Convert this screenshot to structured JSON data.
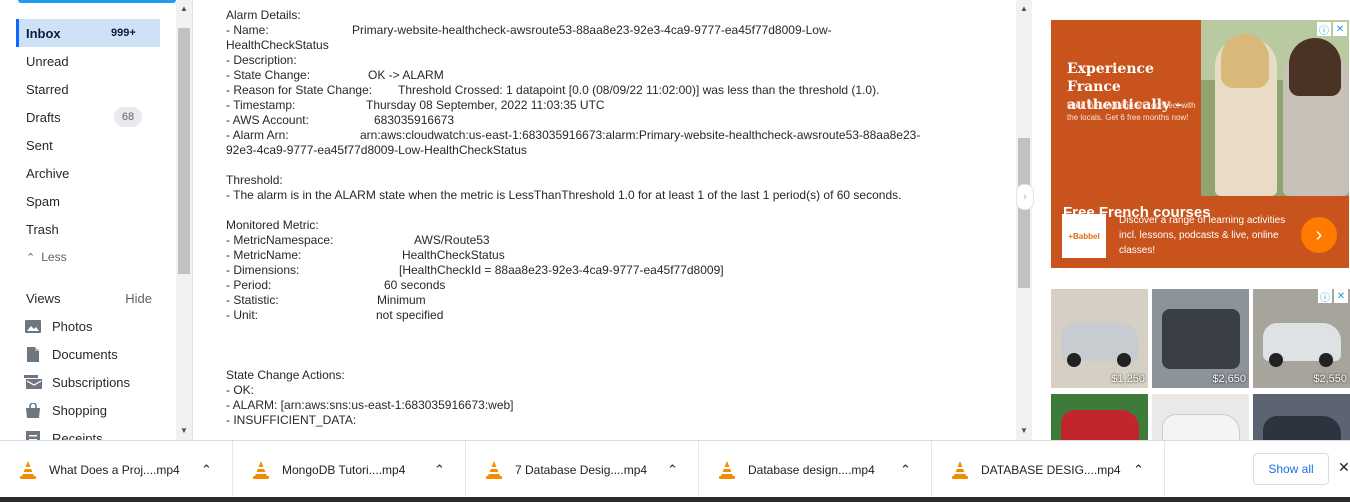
{
  "sidebar": {
    "folders": [
      {
        "label": "Inbox",
        "count": "999+"
      },
      {
        "label": "Unread"
      },
      {
        "label": "Starred"
      },
      {
        "label": "Drafts",
        "badge": "68"
      },
      {
        "label": "Sent"
      },
      {
        "label": "Archive"
      },
      {
        "label": "Spam"
      },
      {
        "label": "Trash"
      }
    ],
    "less_label": "Less",
    "views_label": "Views",
    "hide_label": "Hide",
    "views": [
      {
        "label": "Photos",
        "icon": "photos-icon"
      },
      {
        "label": "Documents",
        "icon": "document-icon"
      },
      {
        "label": "Subscriptions",
        "icon": "subscriptions-icon"
      },
      {
        "label": "Shopping",
        "icon": "shopping-bag-icon"
      },
      {
        "label": "Receipts",
        "icon": "receipt-icon"
      }
    ]
  },
  "message": {
    "alarm_header": "Alarm Details:",
    "name_key": "- Name:",
    "name_val_1": "Primary-website-healthcheck-awsroute53-88aa8e23-92e3-4ca9-9777-ea45f77d8009-Low-",
    "name_val_2": "HealthCheckStatus",
    "description_key": "- Description:",
    "state_change_key": "- State Change:",
    "state_change_val": "OK -> ALARM",
    "reason_key": "- Reason for State Change:",
    "reason_val": "Threshold Crossed: 1 datapoint [0.0 (08/09/22 11:02:00)] was less than the threshold (1.0).",
    "timestamp_key": "- Timestamp:",
    "timestamp_val": "Thursday 08 September, 2022 11:03:35 UTC",
    "account_key": "- AWS Account:",
    "account_val": "683035916673",
    "arn_key": "- Alarm Arn:",
    "arn_val_1": "arn:aws:cloudwatch:us-east-1:683035916673:alarm:Primary-website-healthcheck-awsroute53-88aa8e23-",
    "arn_val_2": "92e3-4ca9-9777-ea45f77d8009-Low-HealthCheckStatus",
    "threshold_header": "Threshold:",
    "threshold_text": "- The alarm is in the ALARM state when the metric is LessThanThreshold 1.0 for at least 1 of the last 1 period(s) of 60 seconds.",
    "metric_header": "Monitored Metric:",
    "namespace_key": "- MetricNamespace:",
    "namespace_val": "AWS/Route53",
    "metricname_key": "- MetricName:",
    "metricname_val": "HealthCheckStatus",
    "dimensions_key": "- Dimensions:",
    "dimensions_val": "[HealthCheckId = 88aa8e23-92e3-4ca9-9777-ea45f77d8009]",
    "period_key": "- Period:",
    "period_val": "60 seconds",
    "statistic_key": "- Statistic:",
    "statistic_val": "Minimum",
    "unit_key": "- Unit:",
    "unit_val": "not specified",
    "actions_header": "State Change Actions:",
    "ok_line": "- OK:",
    "alarm_line": "- ALARM: [arn:aws:sns:us-east-1:683035916673:web]",
    "insufficient_line": "- INSUFFICIENT_DATA:"
  },
  "ads": {
    "babbel": {
      "headline": "Experience France authentically –",
      "subtext": "learn the language and connect with the locals. Get 6 free months now!",
      "title": "Free French courses",
      "logo": "+Babbel",
      "description": "Discover a range of learning activities incl. lessons, podcasts & live, online classes!",
      "cta_icon": "chevron-right-icon",
      "accent_color": "#c9531c"
    },
    "cars": {
      "prices": [
        "$1,250",
        "$2,650",
        "$2,550"
      ]
    }
  },
  "downloads": {
    "items": [
      {
        "name": "What Does a Proj....mp4"
      },
      {
        "name": "MongoDB Tutori....mp4"
      },
      {
        "name": "7 Database Desig....mp4"
      },
      {
        "name": "Database design....mp4"
      },
      {
        "name": "DATABASE DESIG....mp4"
      }
    ],
    "show_all": "Show all"
  }
}
